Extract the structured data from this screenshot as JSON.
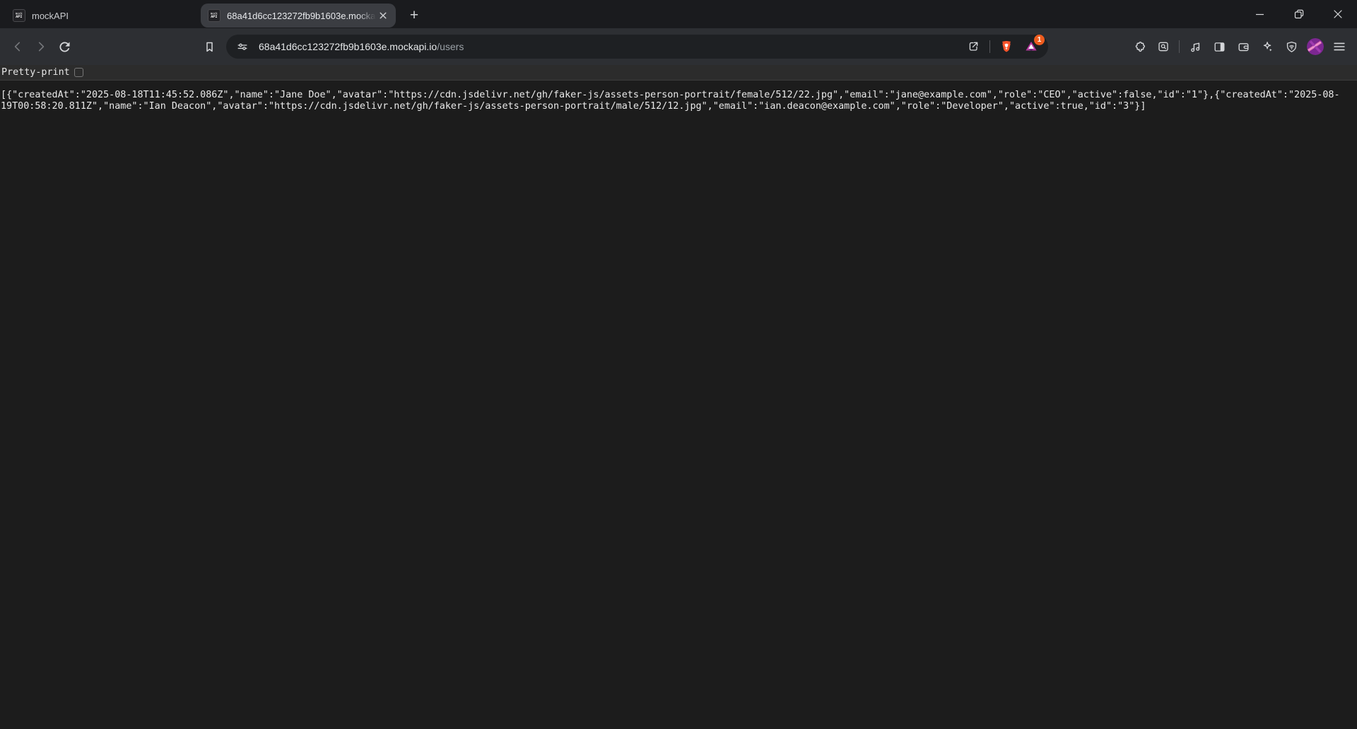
{
  "tab_strip": {
    "tabs": [
      {
        "title": "mockAPI",
        "favicon_line1": "mock",
        "favicon_line2": "API",
        "active": false
      },
      {
        "title": "68a41d6cc123272fb9b1603e.mocka",
        "favicon_line1": "mock",
        "favicon_line2": "API",
        "active": true
      }
    ],
    "new_tab_label": "+"
  },
  "window": {
    "controls": [
      "minimize",
      "restore",
      "close"
    ]
  },
  "toolbar": {
    "url_host": "68a41d6cc123272fb9b1603e.mockapi.io",
    "url_path": "/users",
    "rewards_badge": "1"
  },
  "page": {
    "pretty_print_label": "Pretty-print",
    "pretty_print_checked": false,
    "json_lines": [
      "[{\"createdAt\":\"2025-08-18T11:45:52.086Z\",\"name\":\"Jane Doe\",\"avatar\":\"https://cdn.jsdelivr.net/gh/faker-js/assets-person-portrait/female/512/22.jpg\",\"email\":\"jane@example.com\",\"role\":\"CEO\",\"active\":false,\"id\":\"1\"},{\"createdAt\":\"2025-08-",
      "19T00:58:20.811Z\",\"name\":\"Ian Deacon\",\"avatar\":\"https://cdn.jsdelivr.net/gh/faker-js/assets-person-portrait/male/512/12.jpg\",\"email\":\"ian.deacon@example.com\",\"role\":\"Developer\",\"active\":true,\"id\":\"3\"}]"
    ]
  },
  "icons": {
    "toolbar_left": [
      "back-icon",
      "forward-icon",
      "reload-icon",
      "bookmark-icon"
    ],
    "urlbar": [
      "tune-icon",
      "share-icon",
      "brave-shield-icon",
      "brave-rewards-icon"
    ],
    "toolbar_right": [
      "extensions-icon",
      "tab-search-icon",
      "media-icon",
      "sidebar-icon",
      "wallet-icon",
      "leo-ai-icon",
      "vpn-shield-icon",
      "profile-avatar",
      "menu-icon"
    ],
    "window_controls": [
      "minimize-icon",
      "restore-icon",
      "close-icon"
    ]
  },
  "colors": {
    "brave_shield": "#fb542b",
    "rewards_badge_bg": "#ee5c1e",
    "avatar_purple": "#7c2791",
    "avatar_pink": "#e06ab5",
    "toolbar_bg": "#2d2f33",
    "frame_bg": "#1a1b1e",
    "content_bg": "#1c1c1c"
  }
}
